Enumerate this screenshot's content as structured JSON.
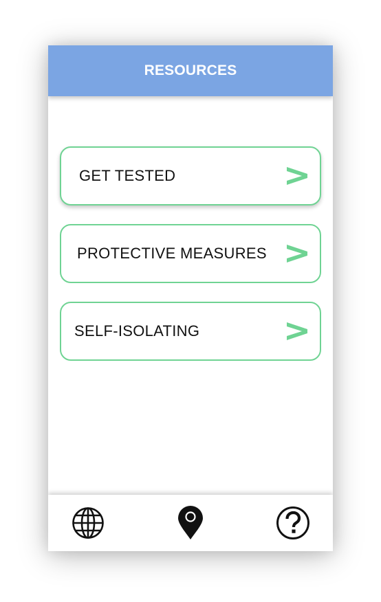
{
  "header": {
    "title": "RESOURCES"
  },
  "cards": [
    {
      "label": "GET TESTED",
      "chevron": ">"
    },
    {
      "label": "PROTECTIVE MEASURES",
      "chevron": ">"
    },
    {
      "label": "SELF-ISOLATING",
      "chevron": ">"
    }
  ],
  "bottom_nav": {
    "items": [
      {
        "icon": "globe-icon"
      },
      {
        "icon": "map-pin-icon"
      },
      {
        "icon": "help-icon"
      }
    ]
  },
  "colors": {
    "header_bg": "#7ba5e3",
    "card_border": "#6fd393",
    "chevron": "#6fd393"
  }
}
